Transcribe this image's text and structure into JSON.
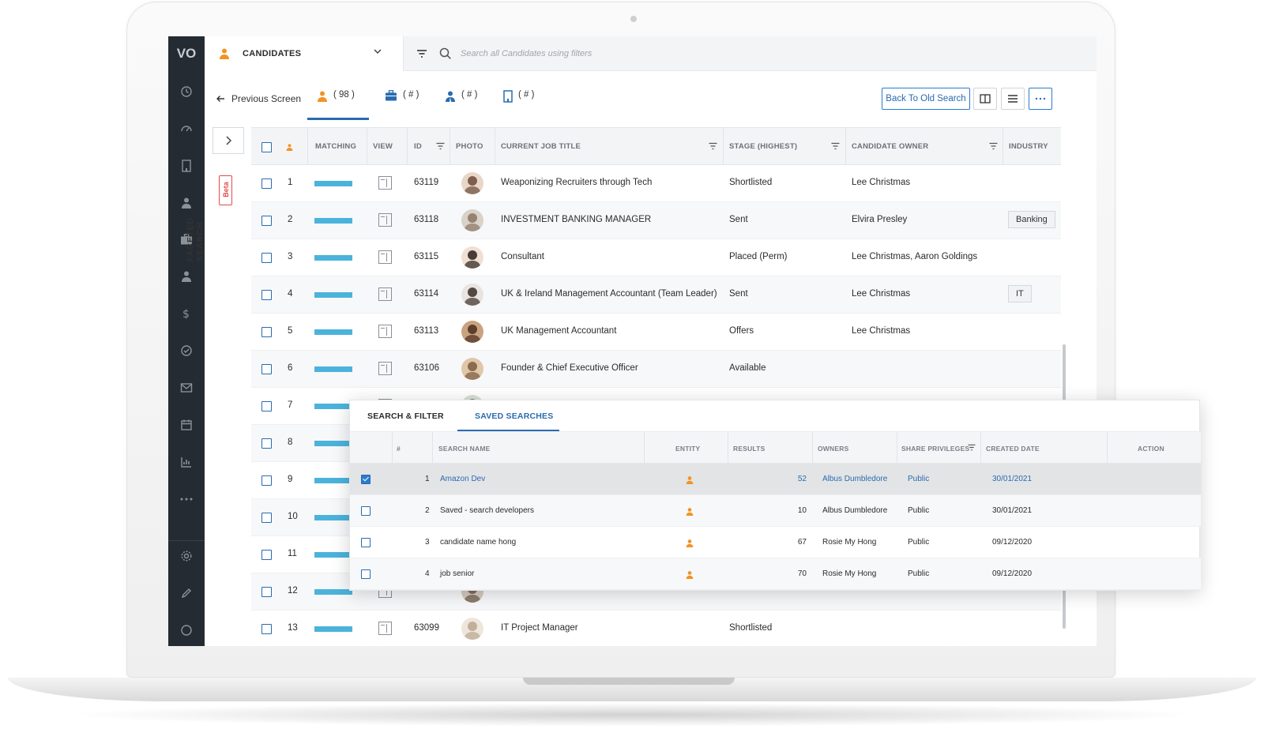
{
  "app": {
    "logo_text": "VO",
    "accent_color": "#2a6bb0",
    "entity_color": "#f39323"
  },
  "topbar": {
    "entity_label": "CANDIDATES",
    "search_placeholder": "Search all Candidates using filters"
  },
  "tabs": {
    "previous_screen": "Previous Screen",
    "candidates_count": "( 98 )",
    "jobs_count": "( # )",
    "contacts_count": "( # )",
    "companies_count": "( # )",
    "back_to_old_search": "Back To Old Search"
  },
  "facet": {
    "beta": "Beta",
    "label": "FACETED SEARCH"
  },
  "grid": {
    "headers": {
      "matching": "MATCHING",
      "view": "VIEW",
      "id": "ID",
      "photo": "PHOTO",
      "job_title": "CURRENT JOB TITLE",
      "stage": "STAGE (HIGHEST)",
      "owner": "CANDIDATE OWNER",
      "industry": "INDUSTRY"
    },
    "rows": [
      {
        "n": "1",
        "id": "63119",
        "title": "Weaponizing Recruiters through Tech",
        "stage": "Shortlisted",
        "owner": "Lee Christmas",
        "industry": ""
      },
      {
        "n": "2",
        "id": "63118",
        "title": "INVESTMENT BANKING MANAGER",
        "stage": "Sent",
        "owner": "Elvira Presley",
        "industry": "Banking"
      },
      {
        "n": "3",
        "id": "63115",
        "title": "Consultant",
        "stage": "Placed (Perm)",
        "owner": "Lee Christmas, Aaron Goldings",
        "industry": ""
      },
      {
        "n": "4",
        "id": "63114",
        "title": "UK & Ireland Management Accountant (Team Leader)",
        "stage": "Sent",
        "owner": "Lee Christmas",
        "industry": "IT"
      },
      {
        "n": "5",
        "id": "63113",
        "title": "UK Management Accountant",
        "stage": "Offers",
        "owner": "Lee Christmas",
        "industry": ""
      },
      {
        "n": "6",
        "id": "63106",
        "title": "Founder & Chief Executive Officer",
        "stage": "Available",
        "owner": "",
        "industry": ""
      },
      {
        "n": "7",
        "id": "",
        "title": "",
        "stage": "",
        "owner": "",
        "industry": ""
      },
      {
        "n": "8",
        "id": "",
        "title": "",
        "stage": "",
        "owner": "",
        "industry": ""
      },
      {
        "n": "9",
        "id": "",
        "title": "",
        "stage": "",
        "owner": "",
        "industry": ""
      },
      {
        "n": "10",
        "id": "",
        "title": "",
        "stage": "",
        "owner": "",
        "industry": ""
      },
      {
        "n": "11",
        "id": "",
        "title": "",
        "stage": "",
        "owner": "",
        "industry": ""
      },
      {
        "n": "12",
        "id": "",
        "title": "",
        "stage": "",
        "owner": "",
        "industry": ""
      },
      {
        "n": "13",
        "id": "63099",
        "title": "IT Project Manager",
        "stage": "Shortlisted",
        "owner": "",
        "industry": ""
      }
    ]
  },
  "saved_searches": {
    "tab_search_filter": "SEARCH & FILTER",
    "tab_saved": "SAVED SEARCHES",
    "headers": {
      "hash": "#",
      "name": "SEARCH NAME",
      "entity": "ENTITY",
      "results": "RESULTS",
      "owners": "OWNERS",
      "share": "SHARE PRIVILEGES",
      "created": "CREATED DATE",
      "action": "ACTION"
    },
    "rows": [
      {
        "n": "1",
        "name": "Amazon Dev",
        "results": "52",
        "owners": "Albus Dumbledore",
        "share": "Public",
        "created": "30/01/2021",
        "checked": true
      },
      {
        "n": "2",
        "name": "Saved - search developers",
        "results": "10",
        "owners": "Albus Dumbledore",
        "share": "Public",
        "created": "30/01/2021",
        "checked": false
      },
      {
        "n": "3",
        "name": "candidate name hong",
        "results": "67",
        "owners": "Rosie My Hong",
        "share": "Public",
        "created": "09/12/2020",
        "checked": false
      },
      {
        "n": "4",
        "name": "job senior",
        "results": "70",
        "owners": "Rosie My Hong",
        "share": "Public",
        "created": "09/12/2020",
        "checked": false
      }
    ]
  }
}
